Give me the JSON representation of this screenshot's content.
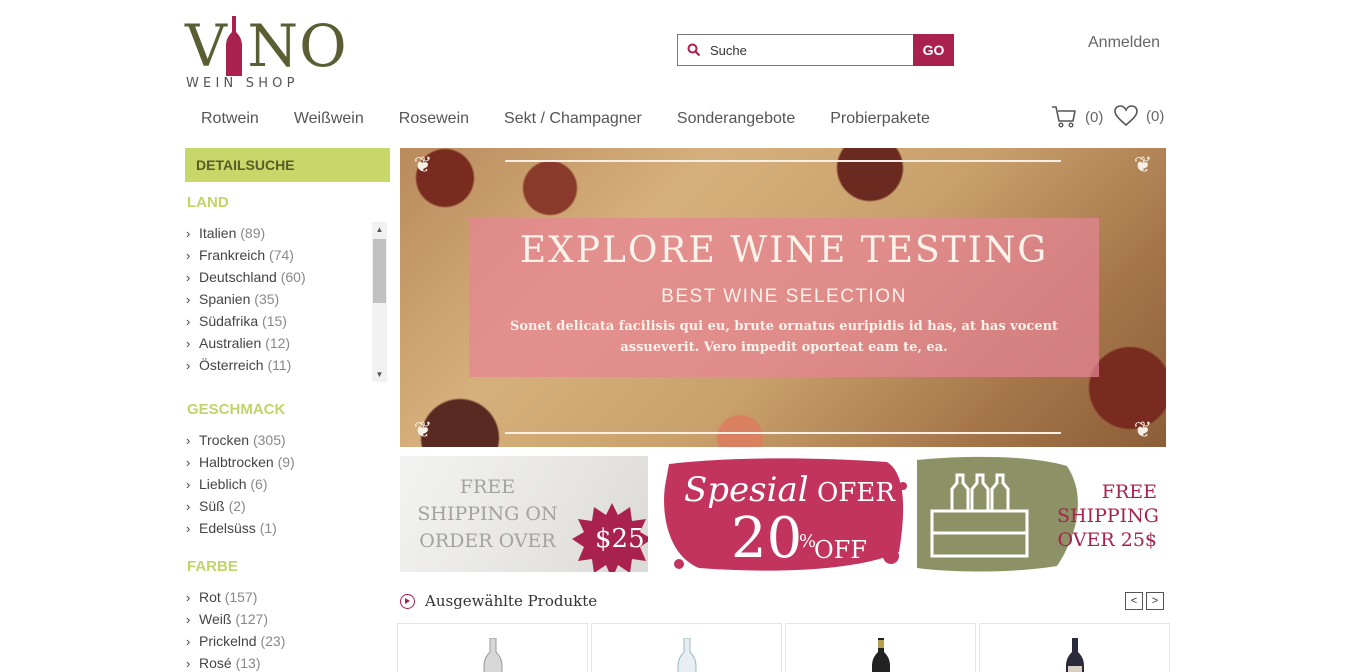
{
  "logo": {
    "word": "VINO",
    "sub": "WEIN SHOP",
    "colors": {
      "text": "#5a5e33",
      "bottle": "#a9214e"
    }
  },
  "search": {
    "placeholder": "Suche",
    "button": "GO"
  },
  "header": {
    "login": "Anmelden"
  },
  "nav": [
    "Rotwein",
    "Weißwein",
    "Rosewein",
    "Sekt / Champagner",
    "Sonderangebote",
    "Probierpakete"
  ],
  "cart": {
    "count": "(0)",
    "icon": "cart-icon"
  },
  "wishlist": {
    "count": "(0)",
    "icon": "heart-icon"
  },
  "sidebar": {
    "heading": "DETAILSUCHE",
    "land": {
      "title": "LAND",
      "items": [
        {
          "label": "Italien",
          "count": "(89)"
        },
        {
          "label": "Frankreich",
          "count": "(74)"
        },
        {
          "label": "Deutschland",
          "count": "(60)"
        },
        {
          "label": "Spanien",
          "count": "(35)"
        },
        {
          "label": "Südafrika",
          "count": "(15)"
        },
        {
          "label": "Australien",
          "count": "(12)"
        },
        {
          "label": "Österreich",
          "count": "(11)"
        }
      ]
    },
    "geschmack": {
      "title": "GESCHMACK",
      "items": [
        {
          "label": "Trocken",
          "count": "(305)"
        },
        {
          "label": "Halbtrocken",
          "count": "(9)"
        },
        {
          "label": "Lieblich",
          "count": "(6)"
        },
        {
          "label": "Süß",
          "count": "(2)"
        },
        {
          "label": "Edelsüss",
          "count": "(1)"
        }
      ]
    },
    "farbe": {
      "title": "FARBE",
      "items": [
        {
          "label": "Rot",
          "count": "(157)"
        },
        {
          "label": "Weiß",
          "count": "(127)"
        },
        {
          "label": "Prickelnd",
          "count": "(23)"
        },
        {
          "label": "Rosé",
          "count": "(13)"
        }
      ]
    }
  },
  "hero": {
    "title": "EXPLORE WINE TESTING",
    "subtitle": "BEST WINE SELECTION",
    "text": "Sonet delicata facilisis qui eu, brute ornatus euripidis id has, at has vocent assueverit. Vero impedit oporteat eam te, ea."
  },
  "promos": {
    "shipping_order": {
      "text": "FREE SHIPPING ON ORDER OVER",
      "price": "$25"
    },
    "special": {
      "script": "Spesial",
      "ofer": "OFER",
      "num": "20",
      "pct": "%",
      "off": "OFF"
    },
    "free_shipping": {
      "line1": "FREE",
      "line2": "SHIPPING",
      "line3": "OVER 25$"
    }
  },
  "featured": {
    "title": "Ausgewählte Produkte",
    "prev": "<",
    "next": ">"
  },
  "colors": {
    "accent": "#a9214e",
    "lime": "#c8d76a",
    "olive": "#5a5e33"
  }
}
